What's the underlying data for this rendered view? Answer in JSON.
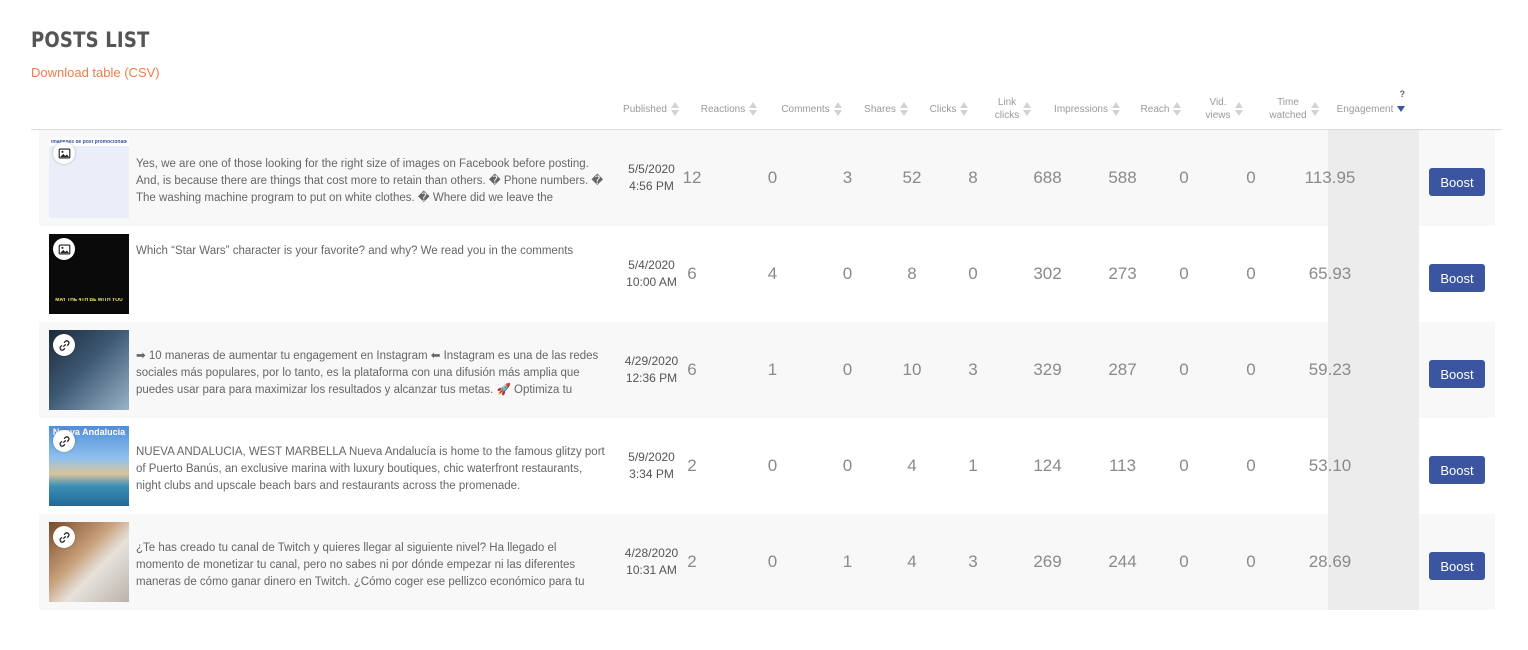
{
  "page": {
    "title": "POSTS LIST",
    "download_label": "Download table (CSV)"
  },
  "colors": {
    "accent_link": "#ee7d48",
    "boost_button": "#3b55a0",
    "engagement_column_bg": "#ececec"
  },
  "columns": {
    "published": "Published",
    "reactions": "Reactions",
    "comments": "Comments",
    "shares": "Shares",
    "clicks": "Clicks",
    "link_clicks_1": "Link",
    "link_clicks_2": "clicks",
    "impressions": "Impressions",
    "reach": "Reach",
    "vid_views_1": "Vid.",
    "vid_views_2": "views",
    "time_watched_1": "Time",
    "time_watched_2": "watched",
    "engagement": "Engagement",
    "engagement_help": "?"
  },
  "posts": [
    {
      "thumb_type": "image-icon",
      "thumb_caption": "imágenes de post promocionados",
      "text": "Yes, we are one of those looking for the right size of images on Facebook before posting. And, is because there are things that cost more to retain than others. � Phone numbers. � The washing machine program to put on white clothes. � Where did we leave the",
      "date": "5/5/2020",
      "time": "4:56 PM",
      "reactions": "12",
      "comments": "0",
      "shares": "3",
      "clicks": "52",
      "link_clicks": "8",
      "impressions": "688",
      "reach": "588",
      "vid_views": "0",
      "time_watched": "0",
      "engagement": "113.95",
      "boost": "Boost"
    },
    {
      "thumb_type": "image-icon",
      "thumb_caption": "MAY THE 4TH BE WITH YOU",
      "text": "Which “Star Wars” character is your favorite? and why? We read you in the comments",
      "date": "5/4/2020",
      "time": "10:00 AM",
      "reactions": "6",
      "comments": "4",
      "shares": "0",
      "clicks": "8",
      "link_clicks": "0",
      "impressions": "302",
      "reach": "273",
      "vid_views": "0",
      "time_watched": "0",
      "engagement": "65.93",
      "boost": "Boost"
    },
    {
      "thumb_type": "link-icon",
      "thumb_caption": "",
      "text": "➡ 10 maneras de aumentar tu engagement en Instagram ⬅ Instagram es una de las redes sociales más populares, por lo tanto, es la plataforma con una difusión más amplia que puedes usar para para maximizar los resultados y alcanzar tus metas. 🚀 Optimiza tu",
      "date": "4/29/2020",
      "time": "12:36 PM",
      "reactions": "6",
      "comments": "1",
      "shares": "0",
      "clicks": "10",
      "link_clicks": "3",
      "impressions": "329",
      "reach": "287",
      "vid_views": "0",
      "time_watched": "0",
      "engagement": "59.23",
      "boost": "Boost"
    },
    {
      "thumb_type": "link-icon",
      "thumb_caption": "Nueva Andalucia",
      "text": "NUEVA ANDALUCIA, WEST MARBELLA Nueva Andalucía is home to the famous glitzy port of Puerto Banús, an exclusive marina with luxury boutiques, chic waterfront restaurants, night clubs and upscale beach bars and restaurants across the promenade.",
      "date": "5/9/2020",
      "time": "3:34 PM",
      "reactions": "2",
      "comments": "0",
      "shares": "0",
      "clicks": "4",
      "link_clicks": "1",
      "impressions": "124",
      "reach": "113",
      "vid_views": "0",
      "time_watched": "0",
      "engagement": "53.10",
      "boost": "Boost"
    },
    {
      "thumb_type": "link-icon",
      "thumb_caption": "",
      "text": "¿Te has creado tu canal de Twitch y quieres llegar al siguiente nivel? Ha llegado el momento de monetizar tu canal, pero no sabes ni por dónde empezar ni las diferentes maneras de cómo ganar dinero en Twitch. ¿Cómo coger ese pellizco económico para tu",
      "date": "4/28/2020",
      "time": "10:31 AM",
      "reactions": "2",
      "comments": "0",
      "shares": "1",
      "clicks": "4",
      "link_clicks": "3",
      "impressions": "269",
      "reach": "244",
      "vid_views": "0",
      "time_watched": "0",
      "engagement": "28.69",
      "boost": "Boost"
    }
  ]
}
